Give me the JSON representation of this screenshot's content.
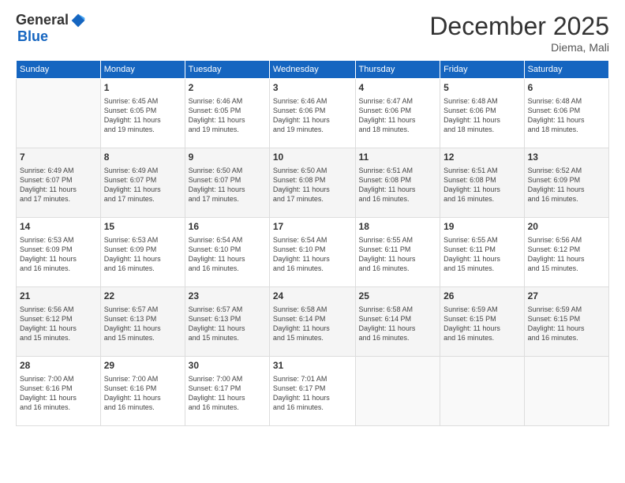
{
  "logo": {
    "general": "General",
    "blue": "Blue"
  },
  "header": {
    "title": "December 2025",
    "location": "Diema, Mali"
  },
  "weekdays": [
    "Sunday",
    "Monday",
    "Tuesday",
    "Wednesday",
    "Thursday",
    "Friday",
    "Saturday"
  ],
  "weeks": [
    [
      {
        "day": "",
        "info": ""
      },
      {
        "day": "1",
        "info": "Sunrise: 6:45 AM\nSunset: 6:05 PM\nDaylight: 11 hours\nand 19 minutes."
      },
      {
        "day": "2",
        "info": "Sunrise: 6:46 AM\nSunset: 6:05 PM\nDaylight: 11 hours\nand 19 minutes."
      },
      {
        "day": "3",
        "info": "Sunrise: 6:46 AM\nSunset: 6:06 PM\nDaylight: 11 hours\nand 19 minutes."
      },
      {
        "day": "4",
        "info": "Sunrise: 6:47 AM\nSunset: 6:06 PM\nDaylight: 11 hours\nand 18 minutes."
      },
      {
        "day": "5",
        "info": "Sunrise: 6:48 AM\nSunset: 6:06 PM\nDaylight: 11 hours\nand 18 minutes."
      },
      {
        "day": "6",
        "info": "Sunrise: 6:48 AM\nSunset: 6:06 PM\nDaylight: 11 hours\nand 18 minutes."
      }
    ],
    [
      {
        "day": "7",
        "info": "Sunrise: 6:49 AM\nSunset: 6:07 PM\nDaylight: 11 hours\nand 17 minutes."
      },
      {
        "day": "8",
        "info": "Sunrise: 6:49 AM\nSunset: 6:07 PM\nDaylight: 11 hours\nand 17 minutes."
      },
      {
        "day": "9",
        "info": "Sunrise: 6:50 AM\nSunset: 6:07 PM\nDaylight: 11 hours\nand 17 minutes."
      },
      {
        "day": "10",
        "info": "Sunrise: 6:50 AM\nSunset: 6:08 PM\nDaylight: 11 hours\nand 17 minutes."
      },
      {
        "day": "11",
        "info": "Sunrise: 6:51 AM\nSunset: 6:08 PM\nDaylight: 11 hours\nand 16 minutes."
      },
      {
        "day": "12",
        "info": "Sunrise: 6:51 AM\nSunset: 6:08 PM\nDaylight: 11 hours\nand 16 minutes."
      },
      {
        "day": "13",
        "info": "Sunrise: 6:52 AM\nSunset: 6:09 PM\nDaylight: 11 hours\nand 16 minutes."
      }
    ],
    [
      {
        "day": "14",
        "info": "Sunrise: 6:53 AM\nSunset: 6:09 PM\nDaylight: 11 hours\nand 16 minutes."
      },
      {
        "day": "15",
        "info": "Sunrise: 6:53 AM\nSunset: 6:09 PM\nDaylight: 11 hours\nand 16 minutes."
      },
      {
        "day": "16",
        "info": "Sunrise: 6:54 AM\nSunset: 6:10 PM\nDaylight: 11 hours\nand 16 minutes."
      },
      {
        "day": "17",
        "info": "Sunrise: 6:54 AM\nSunset: 6:10 PM\nDaylight: 11 hours\nand 16 minutes."
      },
      {
        "day": "18",
        "info": "Sunrise: 6:55 AM\nSunset: 6:11 PM\nDaylight: 11 hours\nand 16 minutes."
      },
      {
        "day": "19",
        "info": "Sunrise: 6:55 AM\nSunset: 6:11 PM\nDaylight: 11 hours\nand 15 minutes."
      },
      {
        "day": "20",
        "info": "Sunrise: 6:56 AM\nSunset: 6:12 PM\nDaylight: 11 hours\nand 15 minutes."
      }
    ],
    [
      {
        "day": "21",
        "info": "Sunrise: 6:56 AM\nSunset: 6:12 PM\nDaylight: 11 hours\nand 15 minutes."
      },
      {
        "day": "22",
        "info": "Sunrise: 6:57 AM\nSunset: 6:13 PM\nDaylight: 11 hours\nand 15 minutes."
      },
      {
        "day": "23",
        "info": "Sunrise: 6:57 AM\nSunset: 6:13 PM\nDaylight: 11 hours\nand 15 minutes."
      },
      {
        "day": "24",
        "info": "Sunrise: 6:58 AM\nSunset: 6:14 PM\nDaylight: 11 hours\nand 15 minutes."
      },
      {
        "day": "25",
        "info": "Sunrise: 6:58 AM\nSunset: 6:14 PM\nDaylight: 11 hours\nand 16 minutes."
      },
      {
        "day": "26",
        "info": "Sunrise: 6:59 AM\nSunset: 6:15 PM\nDaylight: 11 hours\nand 16 minutes."
      },
      {
        "day": "27",
        "info": "Sunrise: 6:59 AM\nSunset: 6:15 PM\nDaylight: 11 hours\nand 16 minutes."
      }
    ],
    [
      {
        "day": "28",
        "info": "Sunrise: 7:00 AM\nSunset: 6:16 PM\nDaylight: 11 hours\nand 16 minutes."
      },
      {
        "day": "29",
        "info": "Sunrise: 7:00 AM\nSunset: 6:16 PM\nDaylight: 11 hours\nand 16 minutes."
      },
      {
        "day": "30",
        "info": "Sunrise: 7:00 AM\nSunset: 6:17 PM\nDaylight: 11 hours\nand 16 minutes."
      },
      {
        "day": "31",
        "info": "Sunrise: 7:01 AM\nSunset: 6:17 PM\nDaylight: 11 hours\nand 16 minutes."
      },
      {
        "day": "",
        "info": ""
      },
      {
        "day": "",
        "info": ""
      },
      {
        "day": "",
        "info": ""
      }
    ]
  ]
}
